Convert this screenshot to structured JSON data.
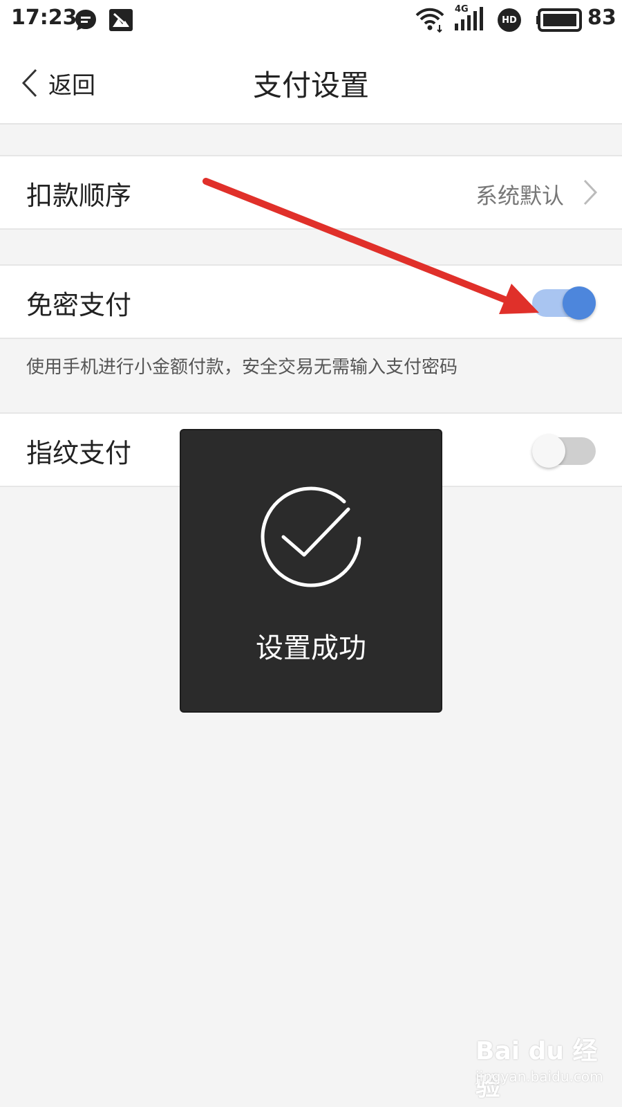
{
  "status_bar": {
    "time": "17:23",
    "battery": "83",
    "icons": [
      "chat-bubble-icon",
      "image-app-icon",
      "wifi-icon",
      "signal-4g-icon",
      "hd-icon",
      "battery-icon"
    ],
    "signal_label": "4G",
    "hd_label": "HD"
  },
  "nav": {
    "back_label": "返回",
    "title": "支付设置"
  },
  "settings": {
    "deduction_order": {
      "label": "扣款顺序",
      "value": "系统默认"
    },
    "password_free_payment": {
      "label": "免密支付",
      "enabled": true,
      "description": "使用手机进行小金额付款，安全交易无需输入支付密码"
    },
    "fingerprint_payment": {
      "label": "指纹支付",
      "enabled": false
    }
  },
  "toast": {
    "icon": "check-circle-icon",
    "message": "设置成功"
  },
  "colors": {
    "accent": "#4d86dc",
    "toggle_track_on": "#a9c5f1",
    "annotation_arrow": "#e0302a",
    "toast_bg": "#2b2b2b"
  },
  "watermark": {
    "brand": "Bai du 经验",
    "url": "jingyan.baidu.com"
  }
}
